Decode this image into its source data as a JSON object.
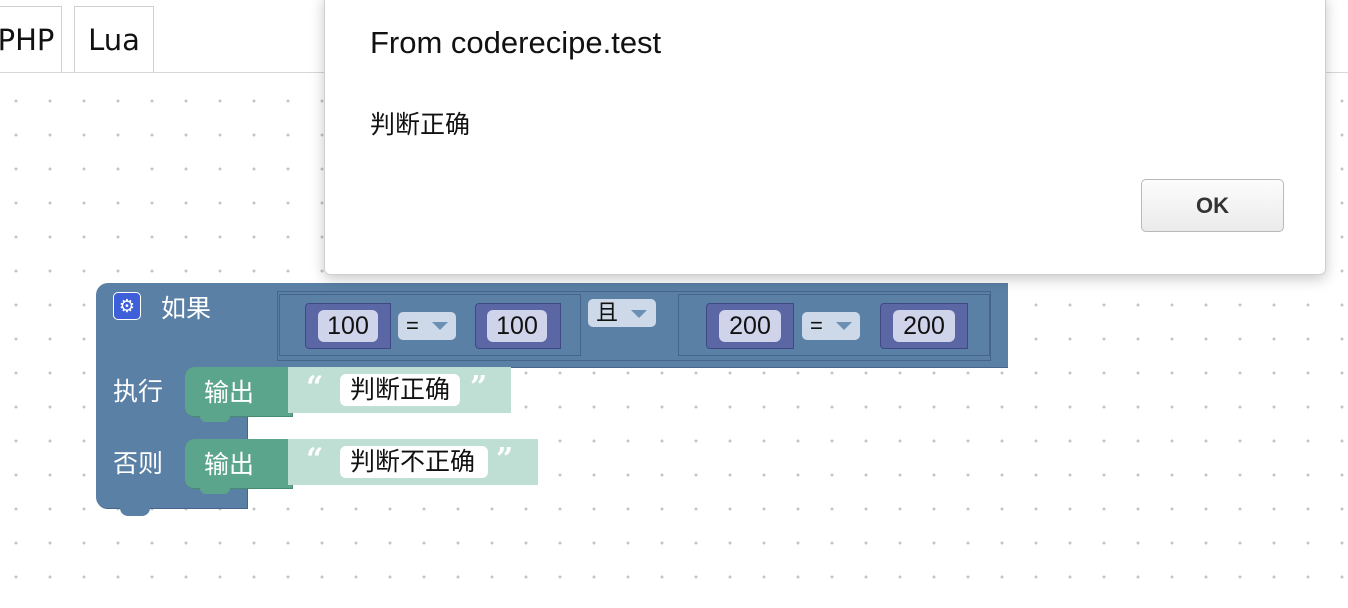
{
  "tabs": [
    {
      "label": "PHP"
    },
    {
      "label": "Lua"
    }
  ],
  "dialog": {
    "title": "From coderecipe.test",
    "message": "判断正确",
    "ok_label": "OK"
  },
  "blocks": {
    "if_label": "如果",
    "do_label": "执行",
    "else_label": "否则",
    "and_op": "且",
    "compare1": {
      "left": "100",
      "op": "=",
      "right": "100"
    },
    "compare2": {
      "left": "200",
      "op": "=",
      "right": "200"
    },
    "print_label": "输出",
    "print1_text": "判断正确",
    "print2_text": "判断不正确",
    "open_quote": "“",
    "close_quote": "”"
  },
  "colors": {
    "logic_block": "#5b80a5",
    "math_block": "#5b67a5",
    "text_block": "#5ba58c",
    "string_field": "#bfdfd4",
    "gear_icon": "#3d5fd8"
  }
}
